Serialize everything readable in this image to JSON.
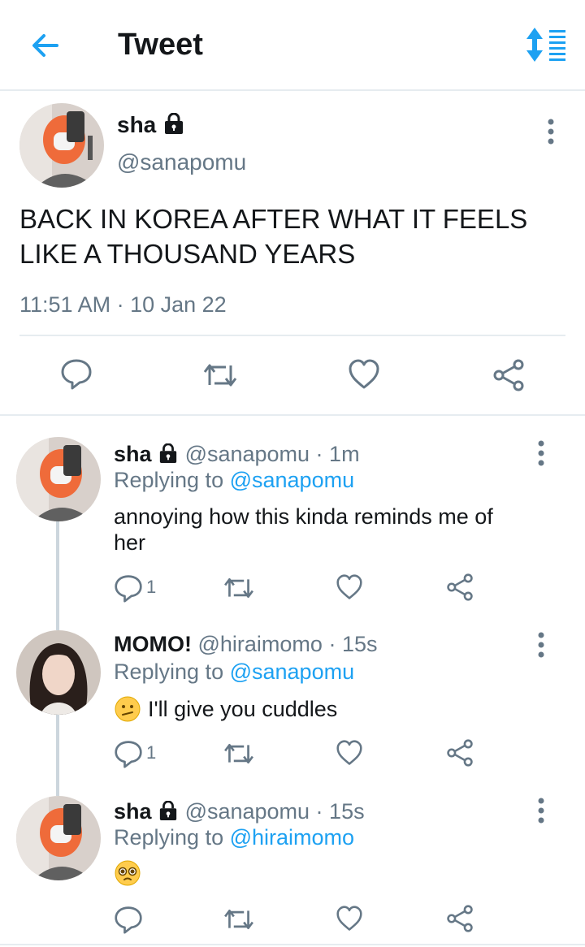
{
  "header": {
    "title": "Tweet"
  },
  "main_tweet": {
    "name": "sha",
    "handle": "@sanapomu",
    "text_line1": "BACK IN KOREA AFTER WHAT IT FEELS",
    "text_line2": "LIKE A THOUSAND YEARS",
    "timestamp": "11:51 AM · 10 Jan 22"
  },
  "replies": [
    {
      "name": "sha",
      "meta": "@sanapomu · 1m",
      "replying_prefix": "Replying to ",
      "replying_handle": "@sanapomu",
      "text_line1": "annoying how this kinda reminds me of",
      "text_line2": "her",
      "reply_count": "1"
    },
    {
      "name": "MOMO!",
      "meta": "@hiraimomo · 15s",
      "replying_prefix": "Replying to ",
      "replying_handle": "@sanapomu",
      "text": "I'll give you cuddles",
      "emoji": "😕",
      "reply_count": "1"
    },
    {
      "name": "sha",
      "meta": "@sanapomu · 15s",
      "replying_prefix": "Replying to ",
      "replying_handle": "@hiraimomo",
      "emoji": "🥺"
    }
  ],
  "colors": {
    "accent": "#1da1f2",
    "muted": "#657786",
    "divider": "#e6ecf0"
  },
  "icons": [
    "back-arrow-icon",
    "sort-icon",
    "lock-icon",
    "more-vertical-icon",
    "reply-icon",
    "retweet-icon",
    "like-icon",
    "share-icon"
  ]
}
